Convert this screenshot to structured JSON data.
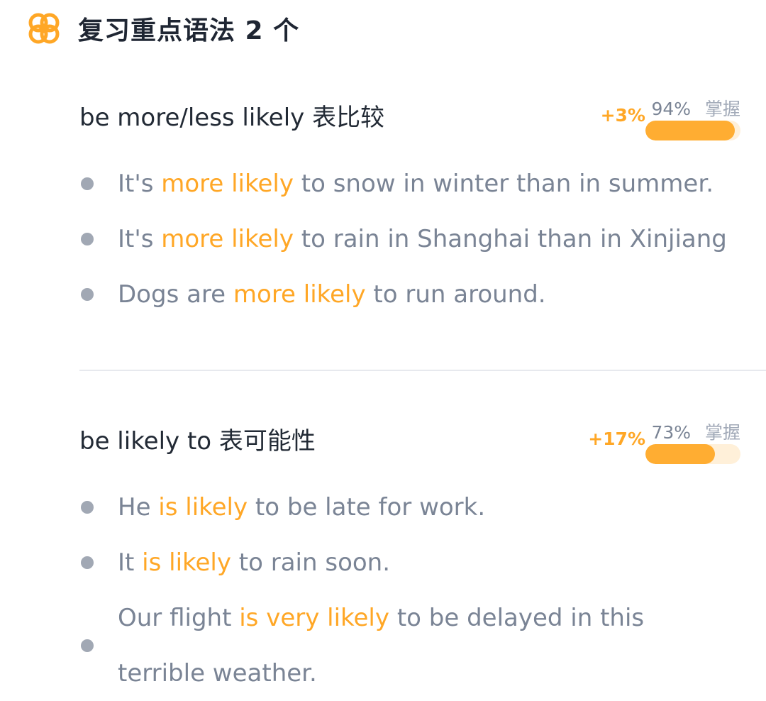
{
  "header": {
    "icon": "orange-ring-knot-icon",
    "title": "复习重点语法 2 个"
  },
  "sections": [
    {
      "title": "be more/less likely 表比较",
      "delta": "+3%",
      "percent": "94%",
      "mastery_label": "掌握",
      "progress": 0.94,
      "examples": [
        {
          "before": "It's ",
          "highlight": "more likely",
          "after": " to snow in winter than in summer."
        },
        {
          "before": "It's ",
          "highlight": "more likely",
          "after": " to rain in Shanghai than in Xinjiang"
        },
        {
          "before": "Dogs are ",
          "highlight": "more likely",
          "after": " to run around."
        }
      ]
    },
    {
      "title": "be likely to 表可能性",
      "delta": "+17%",
      "percent": "73%",
      "mastery_label": "掌握",
      "progress": 0.73,
      "examples": [
        {
          "before": "He ",
          "highlight": "is likely",
          "after": " to be late for work."
        },
        {
          "before": "It ",
          "highlight": "is likely",
          "after": " to rain soon."
        },
        {
          "before": "Our flight ",
          "highlight": "is very likely",
          "after": " to be delayed in this terrible weather."
        }
      ]
    }
  ],
  "colors": {
    "accent": "#ffa726",
    "progress_track": "#fff0d9",
    "text_primary": "#222a35",
    "text_secondary": "#7a8495",
    "bullet": "#a1a8b4",
    "divider": "#e7e9ee"
  }
}
